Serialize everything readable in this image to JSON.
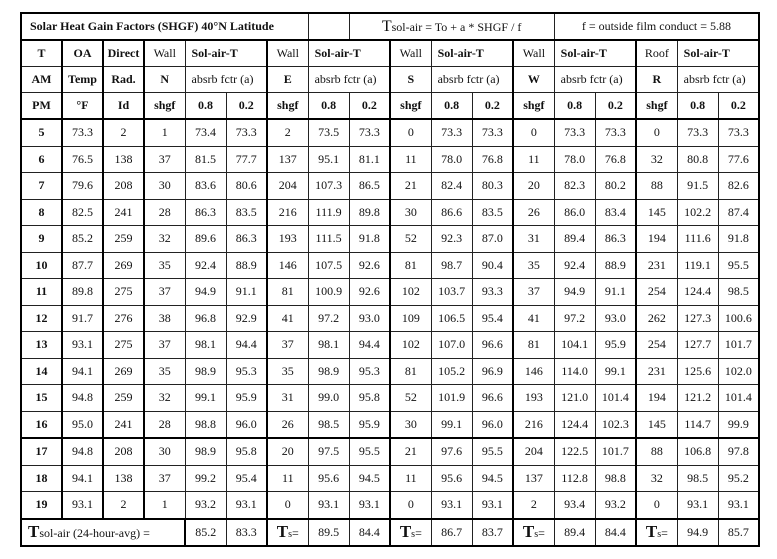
{
  "title": "Solar Heat Gain Factors (SHGF) 40°N Latitude",
  "formula": {
    "big": "T",
    "rest": "sol-air = To + a * SHGF / f"
  },
  "film_note": "f = outside film conduct = 5.88",
  "header": {
    "row1": [
      "T",
      "OA",
      "Direct",
      "Wall",
      "Sol-air-T",
      "Wall",
      "Sol-air-T",
      "Wall",
      "Sol-air-T",
      "Wall",
      "Sol-air-T",
      "Roof",
      "Sol-air-T"
    ],
    "row2": [
      "AM",
      "Temp",
      "Rad.",
      "N",
      "absrb fctr (a)",
      "E",
      "absrb fctr (a)",
      "S",
      "absrb fctr (a)",
      "W",
      "absrb fctr (a)",
      "R",
      "absrb fctr (a)"
    ],
    "row3": [
      "PM",
      "°F",
      "Id",
      "shgf",
      "0.8",
      "0.2",
      "shgf",
      "0.8",
      "0.2",
      "shgf",
      "0.8",
      "0.2",
      "shgf",
      "0.8",
      "0.2",
      "shgf",
      "0.8",
      "0.2"
    ]
  },
  "rows": [
    [
      "5",
      "73.3",
      "2",
      "1",
      "73.4",
      "73.3",
      "2",
      "73.5",
      "73.3",
      "0",
      "73.3",
      "73.3",
      "0",
      "73.3",
      "73.3",
      "0",
      "73.3",
      "73.3"
    ],
    [
      "6",
      "76.5",
      "138",
      "37",
      "81.5",
      "77.7",
      "137",
      "95.1",
      "81.1",
      "11",
      "78.0",
      "76.8",
      "11",
      "78.0",
      "76.8",
      "32",
      "80.8",
      "77.6"
    ],
    [
      "7",
      "79.6",
      "208",
      "30",
      "83.6",
      "80.6",
      "204",
      "107.3",
      "86.5",
      "21",
      "82.4",
      "80.3",
      "20",
      "82.3",
      "80.2",
      "88",
      "91.5",
      "82.6"
    ],
    [
      "8",
      "82.5",
      "241",
      "28",
      "86.3",
      "83.5",
      "216",
      "111.9",
      "89.8",
      "30",
      "86.6",
      "83.5",
      "26",
      "86.0",
      "83.4",
      "145",
      "102.2",
      "87.4"
    ],
    [
      "9",
      "85.2",
      "259",
      "32",
      "89.6",
      "86.3",
      "193",
      "111.5",
      "91.8",
      "52",
      "92.3",
      "87.0",
      "31",
      "89.4",
      "86.3",
      "194",
      "111.6",
      "91.8"
    ],
    [
      "10",
      "87.7",
      "269",
      "35",
      "92.4",
      "88.9",
      "146",
      "107.5",
      "92.6",
      "81",
      "98.7",
      "90.4",
      "35",
      "92.4",
      "88.9",
      "231",
      "119.1",
      "95.5"
    ],
    [
      "11",
      "89.8",
      "275",
      "37",
      "94.9",
      "91.1",
      "81",
      "100.9",
      "92.6",
      "102",
      "103.7",
      "93.3",
      "37",
      "94.9",
      "91.1",
      "254",
      "124.4",
      "98.5"
    ],
    [
      "12",
      "91.7",
      "276",
      "38",
      "96.8",
      "92.9",
      "41",
      "97.2",
      "93.0",
      "109",
      "106.5",
      "95.4",
      "41",
      "97.2",
      "93.0",
      "262",
      "127.3",
      "100.6"
    ],
    [
      "13",
      "93.1",
      "275",
      "37",
      "98.1",
      "94.4",
      "37",
      "98.1",
      "94.4",
      "102",
      "107.0",
      "96.6",
      "81",
      "104.1",
      "95.9",
      "254",
      "127.7",
      "101.7"
    ],
    [
      "14",
      "94.1",
      "269",
      "35",
      "98.9",
      "95.3",
      "35",
      "98.9",
      "95.3",
      "81",
      "105.2",
      "96.9",
      "146",
      "114.0",
      "99.1",
      "231",
      "125.6",
      "102.0"
    ],
    [
      "15",
      "94.8",
      "259",
      "32",
      "99.1",
      "95.9",
      "31",
      "99.0",
      "95.8",
      "52",
      "101.9",
      "96.6",
      "193",
      "121.0",
      "101.4",
      "194",
      "121.2",
      "101.4"
    ],
    [
      "16",
      "95.0",
      "241",
      "28",
      "98.8",
      "96.0",
      "26",
      "98.5",
      "95.9",
      "30",
      "99.1",
      "96.0",
      "216",
      "124.4",
      "102.3",
      "145",
      "114.7",
      "99.9"
    ],
    [
      "17",
      "94.8",
      "208",
      "30",
      "98.9",
      "95.8",
      "20",
      "97.5",
      "95.5",
      "21",
      "97.6",
      "95.5",
      "204",
      "122.5",
      "101.7",
      "88",
      "106.8",
      "97.8"
    ],
    [
      "18",
      "94.1",
      "138",
      "37",
      "99.2",
      "95.4",
      "11",
      "95.6",
      "94.5",
      "11",
      "95.6",
      "94.5",
      "137",
      "112.8",
      "98.8",
      "32",
      "98.5",
      "95.2"
    ],
    [
      "19",
      "93.1",
      "2",
      "1",
      "93.2",
      "93.1",
      "0",
      "93.1",
      "93.1",
      "0",
      "93.1",
      "93.1",
      "2",
      "93.4",
      "93.2",
      "0",
      "93.1",
      "93.1"
    ]
  ],
  "footer": {
    "label_big": "T",
    "label_rest": "sol-air (24-hour-avg) =",
    "ts_big": "T",
    "ts_sub": "s",
    "ts_eq": "=",
    "north": [
      "85.2",
      "83.3"
    ],
    "east": [
      "89.5",
      "84.4"
    ],
    "south": [
      "86.7",
      "83.7"
    ],
    "west": [
      "89.4",
      "84.4"
    ],
    "roof": [
      "94.9",
      "85.7"
    ]
  }
}
